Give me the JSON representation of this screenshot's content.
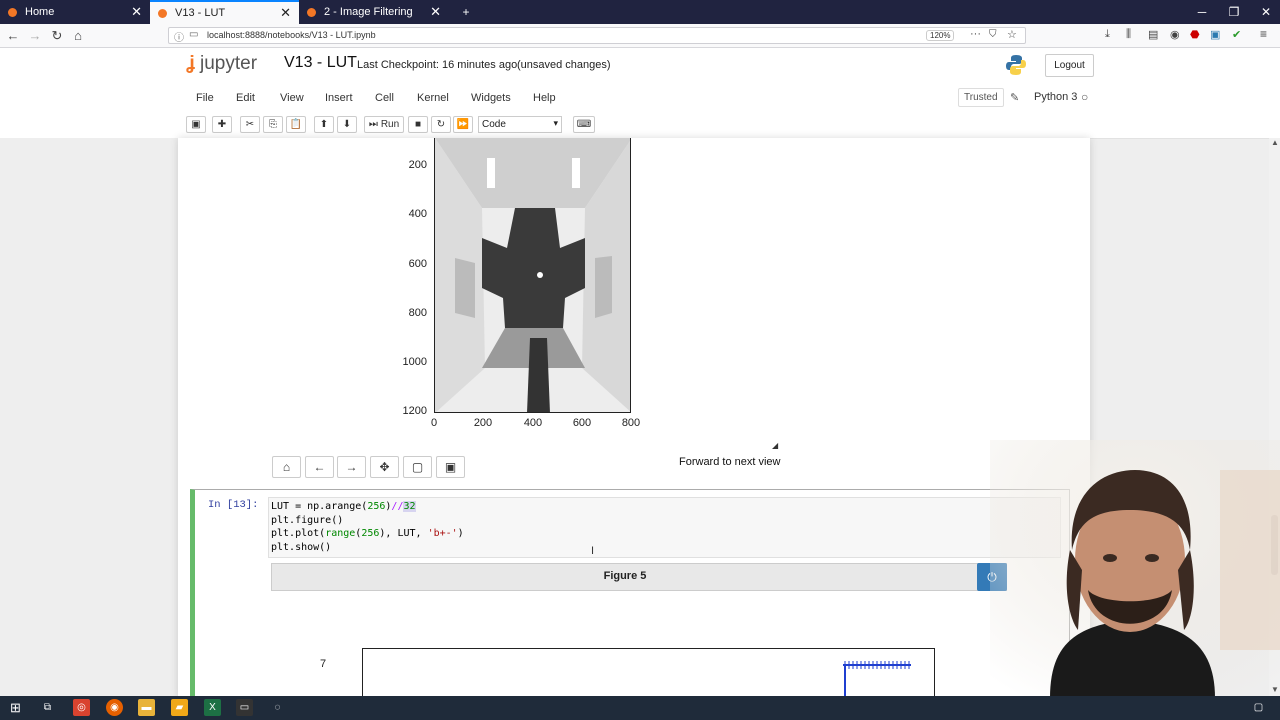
{
  "browser": {
    "tabs": [
      {
        "label": "Home",
        "active": false
      },
      {
        "label": "V13 - LUT",
        "active": true
      },
      {
        "label": "2 - Image Filtering",
        "active": false
      }
    ],
    "url": "localhost:8888/notebooks/V13 - LUT.ipynb",
    "zoom": "120%"
  },
  "jupyter": {
    "logo_text": "jupyter",
    "notebook_title": "V13 - LUT",
    "checkpoint": "Last Checkpoint: 16 minutes ago",
    "unsaved": "(unsaved changes)",
    "logout_label": "Logout",
    "menu": [
      "File",
      "Edit",
      "View",
      "Insert",
      "Cell",
      "Kernel",
      "Widgets",
      "Help"
    ],
    "trusted_label": "Trusted",
    "kernel_name": "Python 3",
    "toolbar": {
      "run_label": "Run",
      "cell_type": "Code"
    }
  },
  "image_plot": {
    "y_ticks": [
      "200",
      "400",
      "600",
      "800",
      "1000",
      "1200"
    ],
    "x_ticks": [
      "0",
      "200",
      "400",
      "600",
      "800"
    ],
    "status_message": "Forward to next view"
  },
  "code_cell": {
    "prompt": "In [13]:",
    "lines": [
      "LUT = np.arange(256)//32",
      "plt.figure()",
      "plt.plot(range(256), LUT, 'b+-')",
      "plt.show()"
    ]
  },
  "figure": {
    "title": "Figure 5",
    "y_tick_visible": "7"
  },
  "colors": {
    "accent_blue": "#337ab7",
    "cell_selected": "#66bb6a",
    "tab_bar": "#202340",
    "jupyter_orange": "#f37726"
  }
}
